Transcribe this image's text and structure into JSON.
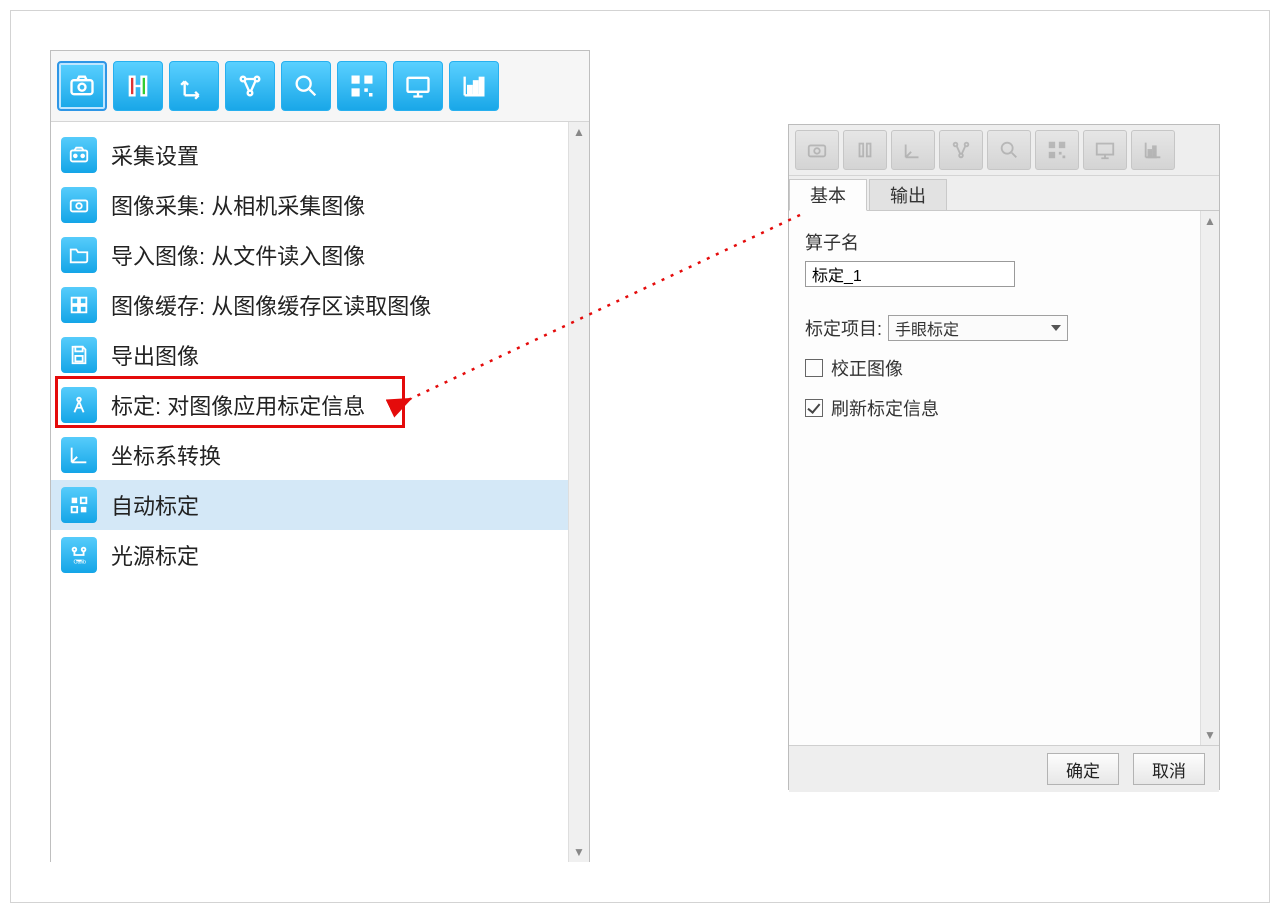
{
  "left": {
    "toolbar_icons": [
      "camera",
      "gauge",
      "arrow-up-right",
      "nodes",
      "search",
      "qr",
      "display",
      "chart"
    ],
    "items": [
      {
        "icon": "settings",
        "label": "采集设置"
      },
      {
        "icon": "camera",
        "label": "图像采集: 从相机采集图像"
      },
      {
        "icon": "folder",
        "label": "导入图像: 从文件读入图像"
      },
      {
        "icon": "cache",
        "label": "图像缓存: 从图像缓存区读取图像"
      },
      {
        "icon": "save",
        "label": "导出图像"
      },
      {
        "icon": "compass",
        "label": "标定: 对图像应用标定信息",
        "red": true
      },
      {
        "icon": "axis",
        "label": "坐标系转换"
      },
      {
        "icon": "auto",
        "label": "自动标定",
        "hover": true
      },
      {
        "icon": "light",
        "label": "光源标定"
      }
    ]
  },
  "right": {
    "toolbar_icons": [
      "camera",
      "gauge",
      "axis",
      "nodes",
      "search",
      "qr",
      "display",
      "chart"
    ],
    "tabs": [
      "基本",
      "输出"
    ],
    "active_tab": 0,
    "field_name_label": "算子名",
    "field_name_value": "标定_1",
    "project_label": "标定项目:",
    "project_value": "手眼标定",
    "checkbox1": {
      "label": "校正图像",
      "checked": false
    },
    "checkbox2": {
      "label": "刷新标定信息",
      "checked": true
    },
    "ok": "确定",
    "cancel": "取消"
  }
}
